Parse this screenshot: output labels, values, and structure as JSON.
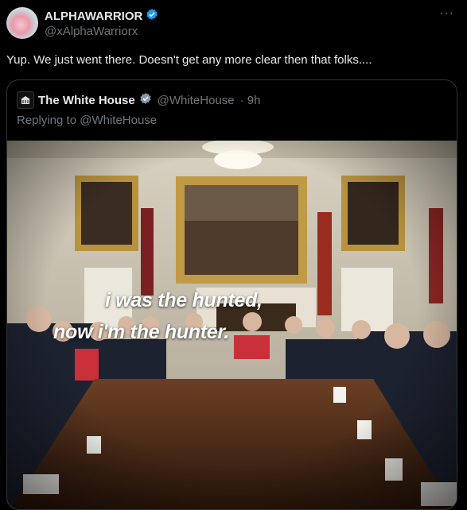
{
  "author": {
    "display_name": "ALPHAWARRIOR",
    "handle": "@xAlphaWarriorx",
    "verified_icon": "verified-badge-icon"
  },
  "more_label": "···",
  "tweet_text": "Yup. We just went there. Doesn't get any more clear then that folks....",
  "quoted": {
    "name": "The White House",
    "handle": "@WhiteHouse",
    "time": "· 9h",
    "replying": "Replying to @WhiteHouse",
    "overlay_line1": "i was the hunted,",
    "overlay_line2": "now i'm the hunter."
  },
  "colors": {
    "verified": "#1d9bf0",
    "muted": "#71767b",
    "border": "#2f3336"
  }
}
